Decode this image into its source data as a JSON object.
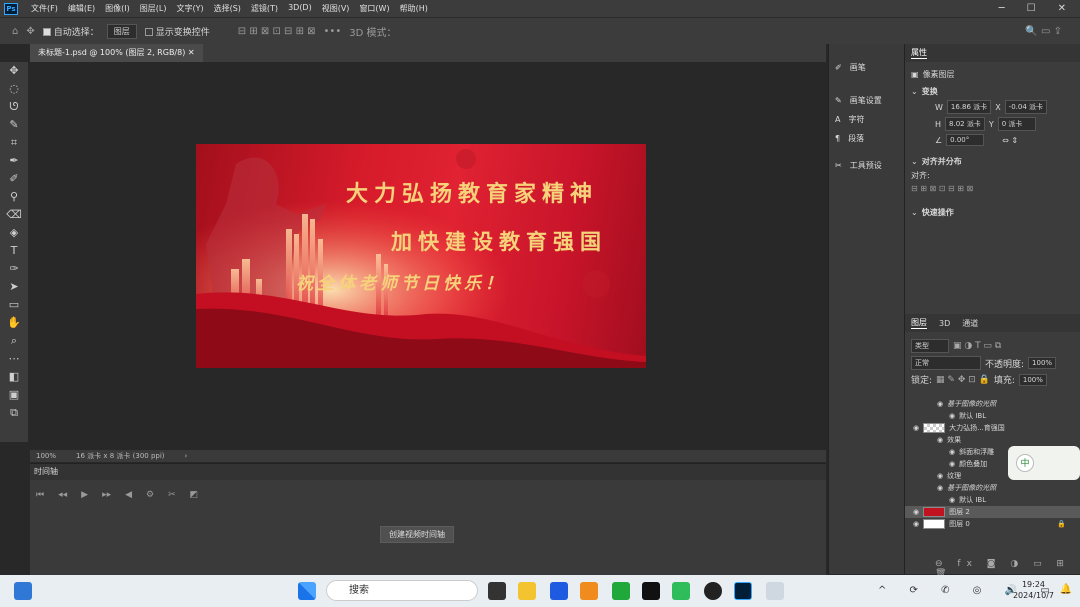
{
  "menu": [
    "文件(F)",
    "编辑(E)",
    "图像(I)",
    "图层(L)",
    "文字(Y)",
    "选择(S)",
    "滤镜(T)",
    "3D(D)",
    "视图(V)",
    "窗口(W)",
    "帮助(H)"
  ],
  "options": {
    "auto_select": "自动选择：",
    "layer_select": "图层",
    "show_transform": "显示变换控件",
    "mode_3d": "3D 模式："
  },
  "document_tab": "未标题-1.psd @ 100% (图层 2, RGB/8)",
  "canvas": {
    "line1": "大力弘扬教育家精神",
    "line2": "加快建设教育强国",
    "line3": "祝全体老师节日快乐！"
  },
  "status": {
    "zoom": "100%",
    "size": "16 派卡 x 8 派卡 (300 ppi)"
  },
  "timeline": {
    "title": "时间轴",
    "create_button": "创建视频时间轴"
  },
  "midstrip": [
    "画笔",
    "画笔设置",
    "字符",
    "段落",
    "工具预设"
  ],
  "properties": {
    "tab": "属性",
    "pixel_layer": "像素图层",
    "transform": "变换",
    "w": "16.86 派卡",
    "x": "-0.04 派卡",
    "h": "8.02 派卡",
    "y": "0 派卡",
    "angle": "0.00°",
    "align_title": "对齐并分布",
    "align_label": "对齐:",
    "quick_actions": "快速操作"
  },
  "layers_panel": {
    "tabs": [
      "图层",
      "3D",
      "通道"
    ],
    "filter": "类型",
    "blend": "正常",
    "opacity_label": "不透明度:",
    "opacity": "100%",
    "lock_label": "锁定:",
    "fill_label": "填充:",
    "fill": "100%"
  },
  "layers": [
    {
      "name": "基于图像的光照",
      "style": "italic",
      "indent": 2
    },
    {
      "name": "默认 IBL",
      "indent": 3
    },
    {
      "name": "大力弘扬...育强国",
      "indent": 0,
      "text": true
    },
    {
      "name": "效果",
      "indent": 2
    },
    {
      "name": "斜面和浮雕",
      "indent": 3
    },
    {
      "name": "颜色叠加",
      "indent": 3
    },
    {
      "name": "纹理",
      "indent": 2
    },
    {
      "name": "基于图像的光照",
      "style": "italic",
      "indent": 2
    },
    {
      "name": "默认 IBL",
      "indent": 3
    },
    {
      "name": "图层 2",
      "indent": 0,
      "selected": true,
      "thumb": "#c0121f"
    },
    {
      "name": "图层 0",
      "indent": 0,
      "thumb": "#ffffff",
      "locked": true
    }
  ],
  "ime_badge": "中",
  "taskbar": {
    "search": "搜索",
    "time": "19:24",
    "date": "2024/10/7"
  },
  "colors": {
    "ps_blue": "#31a8ff",
    "canvas_red": "#d61b2b",
    "gold_text": "#f6d27a"
  }
}
